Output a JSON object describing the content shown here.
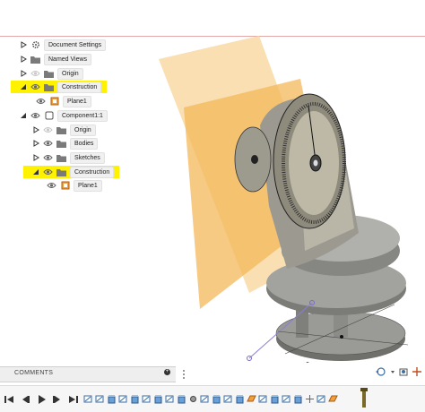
{
  "browser": {
    "items": [
      {
        "label": "Document Settings",
        "icon": "gear-icon",
        "expanded": false,
        "highlight": false
      },
      {
        "label": "Named Views",
        "icon": "folder-icon",
        "expanded": false,
        "highlight": false
      },
      {
        "label": "Origin",
        "icon": "folder-icon",
        "expanded": false,
        "highlight": false,
        "visible": false
      },
      {
        "label": "Construction",
        "icon": "folder-icon",
        "expanded": true,
        "highlight": true,
        "visible": true
      },
      {
        "label": "Plane1",
        "icon": "plane-icon",
        "child": true,
        "highlight": false,
        "visible": true
      },
      {
        "label": "Component1:1",
        "icon": "component-icon",
        "expanded": true,
        "highlight": false,
        "visible": true
      },
      {
        "label": "Origin",
        "icon": "folder-icon",
        "expanded": false,
        "highlight": false,
        "visible": false
      },
      {
        "label": "Bodies",
        "icon": "folder-icon",
        "expanded": false,
        "highlight": false,
        "visible": true
      },
      {
        "label": "Sketches",
        "icon": "folder-icon",
        "expanded": false,
        "highlight": false,
        "visible": true
      },
      {
        "label": "Construction",
        "icon": "folder-icon",
        "expanded": true,
        "highlight": true,
        "visible": true
      },
      {
        "label": "Plane1",
        "icon": "plane-icon",
        "child": true,
        "highlight": false,
        "visible": true
      }
    ]
  },
  "comments": {
    "label": "COMMENTS"
  },
  "colors": {
    "highlight": "#fff200",
    "plane": "#f5c26b",
    "body": "#8a8a86"
  }
}
